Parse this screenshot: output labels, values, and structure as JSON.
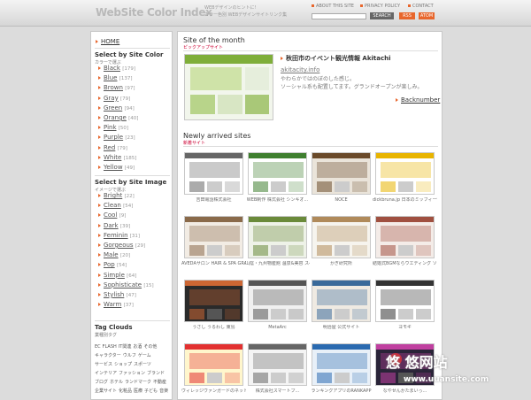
{
  "header": {
    "logo": "WebSite Color Index",
    "tagline1": "WEBデザインのヒントに!",
    "tagline2": "カラー色別 WEBデザインサイトリンク集",
    "nav": [
      "ABOUT THIS SITE",
      "PRIVACY POLICY",
      "CONTACT"
    ],
    "search_button": "SEARCH",
    "rss": "RSS",
    "atom": "ATOM"
  },
  "sidebar": {
    "home": "HOME",
    "color_heading": "Select by Site Color",
    "color_sub": "カラーで選ぶ",
    "colors": [
      {
        "label": "Black",
        "count": "[179]"
      },
      {
        "label": "Blue",
        "count": "[137]"
      },
      {
        "label": "Brown",
        "count": "[97]"
      },
      {
        "label": "Gray",
        "count": "[79]"
      },
      {
        "label": "Green",
        "count": "[94]"
      },
      {
        "label": "Orange",
        "count": "[40]"
      },
      {
        "label": "Pink",
        "count": "[50]"
      },
      {
        "label": "Purple",
        "count": "[23]"
      },
      {
        "label": "Red",
        "count": "[79]"
      },
      {
        "label": "White",
        "count": "[185]"
      },
      {
        "label": "Yellow",
        "count": "[49]"
      }
    ],
    "image_heading": "Select by Site Image",
    "image_sub": "イメージで選ぶ",
    "images": [
      {
        "label": "Bright",
        "count": "[22]"
      },
      {
        "label": "Clean",
        "count": "[54]"
      },
      {
        "label": "Cool",
        "count": "[9]"
      },
      {
        "label": "Dark",
        "count": "[39]"
      },
      {
        "label": "Feminin",
        "count": "[31]"
      },
      {
        "label": "Gorgeous",
        "count": "[29]"
      },
      {
        "label": "Male",
        "count": "[20]"
      },
      {
        "label": "Pop",
        "count": "[54]"
      },
      {
        "label": "Simple",
        "count": "[64]"
      },
      {
        "label": "Sophisticate",
        "count": "[15]"
      },
      {
        "label": "Stylish",
        "count": "[47]"
      },
      {
        "label": "Warm",
        "count": "[37]"
      }
    ],
    "tag_heading": "Tag Clouds",
    "tag_sub": "業種別タグ",
    "tags": [
      "EC",
      "FLASH",
      "IT関連",
      "お酒",
      "その他",
      "キャラクター",
      "ウルフ",
      "ゲーム",
      "サービス",
      "ショップ",
      "スポーツ",
      "インテリア",
      "ファッション",
      "ブランド",
      "ブログ",
      "ホテル",
      "ランドマーク",
      "不動産",
      "企業サイト",
      "化粧品",
      "医療",
      "子ども",
      "音楽"
    ]
  },
  "main": {
    "featured_heading": "Site of the month",
    "featured_sub": "ピックアップサイト",
    "featured_title": "秋田市のイベント観光情報 Akitachi",
    "featured_url": "akitacity.info",
    "featured_desc1": "やわらかではのぼのした感じ。",
    "featured_desc2": "ソーシャル系も配置してます。グランドオープンが楽しみ。",
    "back_number": "Backnumber",
    "new_heading": "Newly arrived sites",
    "new_sub": "新着サイト",
    "sites": [
      {
        "caption": "吉田電話株式会社",
        "bg": "#ffffff",
        "accent": "#666666",
        "dark": false
      },
      {
        "caption": "WEB制作 株式会社 シンキオ...",
        "bg": "#ffffff",
        "accent": "#3f7f2f",
        "dark": false
      },
      {
        "caption": "NOCE",
        "bg": "#eae4da",
        "accent": "#6a4a2a",
        "dark": false
      },
      {
        "caption": "dickbruna.jp 日本のミッフィー情報サイト",
        "bg": "#ffffff",
        "accent": "#e8b400",
        "dark": false
      },
      {
        "caption": "AVEDAサロン HAIR & SPA GRACE(グレイス)",
        "bg": "#f2ece4",
        "accent": "#8a6a4a",
        "dark": false
      },
      {
        "caption": "山陰・九州物産館 温泉&美容 スペシャルサイト",
        "bg": "#eef2e8",
        "accent": "#6a8a3a",
        "dark": false
      },
      {
        "caption": "かぎ研究所",
        "bg": "#f6f4ee",
        "accent": "#b08a5a",
        "dark": false
      },
      {
        "caption": "結婚式BGMならウエディング ソング.com",
        "bg": "#f4ece8",
        "accent": "#a05040",
        "dark": false
      },
      {
        "caption": "うさし うるわし 東島",
        "bg": "#2a2a2a",
        "accent": "#cc6633",
        "dark": true
      },
      {
        "caption": "MetaArc",
        "bg": "#f0f0f0",
        "accent": "#555555",
        "dark": false
      },
      {
        "caption": "明治屋 公式サイト",
        "bg": "#efeae2",
        "accent": "#3a6a9a",
        "dark": false
      },
      {
        "caption": "ヨモギ",
        "bg": "#ffffff",
        "accent": "#333333",
        "dark": false
      },
      {
        "caption": "ヴィレッジヴァンガードのネット通販",
        "bg": "#fff6cc",
        "accent": "#e23030",
        "dark": false
      },
      {
        "caption": "株式会社スマートブ...",
        "bg": "#f4f4f4",
        "accent": "#666666",
        "dark": false
      },
      {
        "caption": "ランキングアプリのRANKAPP",
        "bg": "#e8f0f8",
        "accent": "#2a6ab0",
        "dark": false
      },
      {
        "caption": "なやせんかたまいっ...",
        "bg": "#2a2438",
        "accent": "#c040a0",
        "dark": true
      }
    ]
  },
  "watermark": {
    "text": "悠 悠网站",
    "sub": "www.uuansite.com"
  }
}
